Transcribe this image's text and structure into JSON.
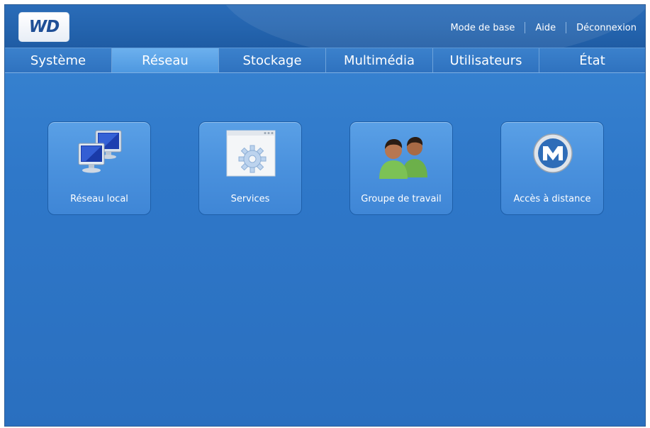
{
  "header": {
    "logo_text": "WD",
    "links": {
      "basic_mode": "Mode de base",
      "help": "Aide",
      "logout": "Déconnexion"
    }
  },
  "tabs": [
    {
      "label": "Système",
      "active": false
    },
    {
      "label": "Réseau",
      "active": true
    },
    {
      "label": "Stockage",
      "active": false
    },
    {
      "label": "Multimédia",
      "active": false
    },
    {
      "label": "Utilisateurs",
      "active": false
    },
    {
      "label": "État",
      "active": false
    }
  ],
  "tiles": [
    {
      "label": "Réseau local",
      "icon": "network-computers-icon"
    },
    {
      "label": "Services",
      "icon": "services-gear-icon"
    },
    {
      "label": "Groupe de travail",
      "icon": "workgroup-users-icon"
    },
    {
      "label": "Accès à distance",
      "icon": "remote-access-icon"
    }
  ],
  "colors": {
    "background": "#2f78c9",
    "header": "#2464ae",
    "active_tab": "#5ca2e6",
    "tile": "#4a91dd"
  }
}
